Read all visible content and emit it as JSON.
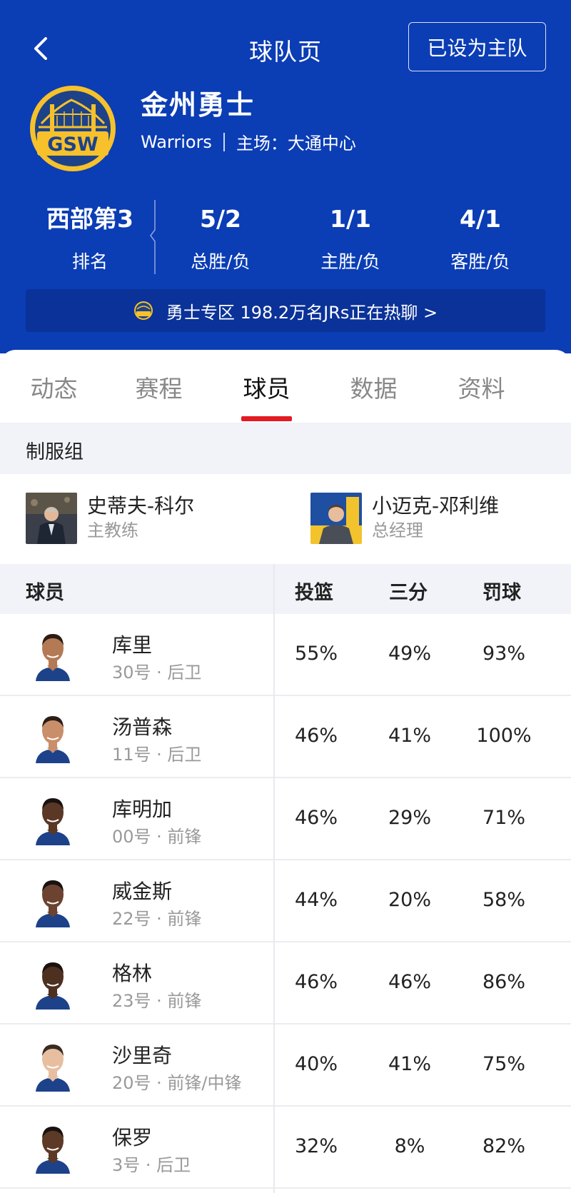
{
  "header": {
    "title": "球队页",
    "home_team_button": "已设为主队"
  },
  "team": {
    "name": "金州勇士",
    "english_name": "Warriors",
    "arena": "主场：大通中心",
    "logo_text": "GSW",
    "colors": {
      "primary": "#0b3db5",
      "gold": "#f6c12a",
      "navy": "#1d428a"
    }
  },
  "stats": [
    {
      "value": "西部第3",
      "label": "排名"
    },
    {
      "value": "5/2",
      "label": "总胜/负"
    },
    {
      "value": "1/1",
      "label": "主胜/负"
    },
    {
      "value": "4/1",
      "label": "客胜/负"
    }
  ],
  "chat_bar": {
    "text": "勇士专区 198.2万名JRs正在热聊 >"
  },
  "tabs": [
    "动态",
    "赛程",
    "球员",
    "数据",
    "资料"
  ],
  "active_tab": "球员",
  "staff_section": {
    "title": "制服组",
    "members": [
      {
        "name": "史蒂夫-科尔",
        "role": "主教练"
      },
      {
        "name": "小迈克-邓利维",
        "role": "总经理"
      }
    ]
  },
  "players_table": {
    "headers": [
      "球员",
      "投篮",
      "三分",
      "罚球"
    ],
    "rows": [
      {
        "name": "库里",
        "meta": "30号 · 后卫",
        "fg": "55%",
        "tp": "49%",
        "ft": "93%"
      },
      {
        "name": "汤普森",
        "meta": "11号 · 后卫",
        "fg": "46%",
        "tp": "41%",
        "ft": "100%"
      },
      {
        "name": "库明加",
        "meta": "00号 · 前锋",
        "fg": "46%",
        "tp": "29%",
        "ft": "71%"
      },
      {
        "name": "威金斯",
        "meta": "22号 · 前锋",
        "fg": "44%",
        "tp": "20%",
        "ft": "58%"
      },
      {
        "name": "格林",
        "meta": "23号 · 前锋",
        "fg": "46%",
        "tp": "46%",
        "ft": "86%"
      },
      {
        "name": "沙里奇",
        "meta": "20号 · 前锋/中锋",
        "fg": "40%",
        "tp": "41%",
        "ft": "75%"
      },
      {
        "name": "保罗",
        "meta": "3号 · 后卫",
        "fg": "32%",
        "tp": "8%",
        "ft": "82%"
      }
    ]
  }
}
